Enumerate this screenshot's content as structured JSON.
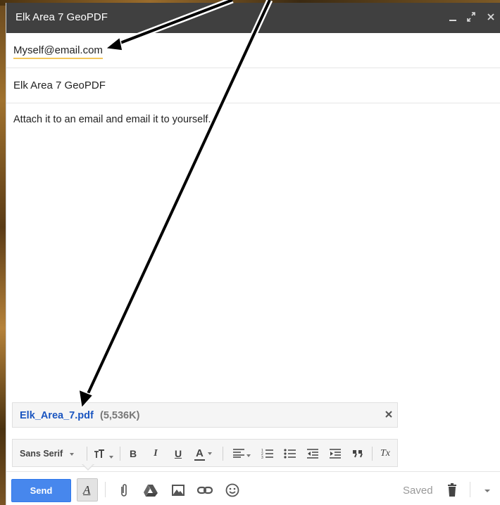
{
  "window": {
    "title": "Elk Area 7 GeoPDF",
    "minimize_icon": "minimize-icon",
    "expand_icon": "expand-icon",
    "close_icon": "close-icon"
  },
  "compose": {
    "to": "Myself@email.com",
    "subject": "Elk Area 7 GeoPDF",
    "body": "Attach it to an email and email it to yourself."
  },
  "attachment": {
    "name": "Elk_Area_7.pdf",
    "size": "(5,536K)",
    "remove_icon": "close-icon"
  },
  "format_bar": {
    "font": "Sans Serif",
    "bold": "B",
    "italic": "I",
    "underline": "U",
    "text_color": "A",
    "clear_format": "Tx"
  },
  "bottom_bar": {
    "send_label": "Send",
    "format_label": "A",
    "status": "Saved"
  },
  "colors": {
    "titlebar": "#404040",
    "send_button": "#4787ed",
    "attachment_link": "#1a55c0",
    "annotation_arrow": "#000000"
  }
}
